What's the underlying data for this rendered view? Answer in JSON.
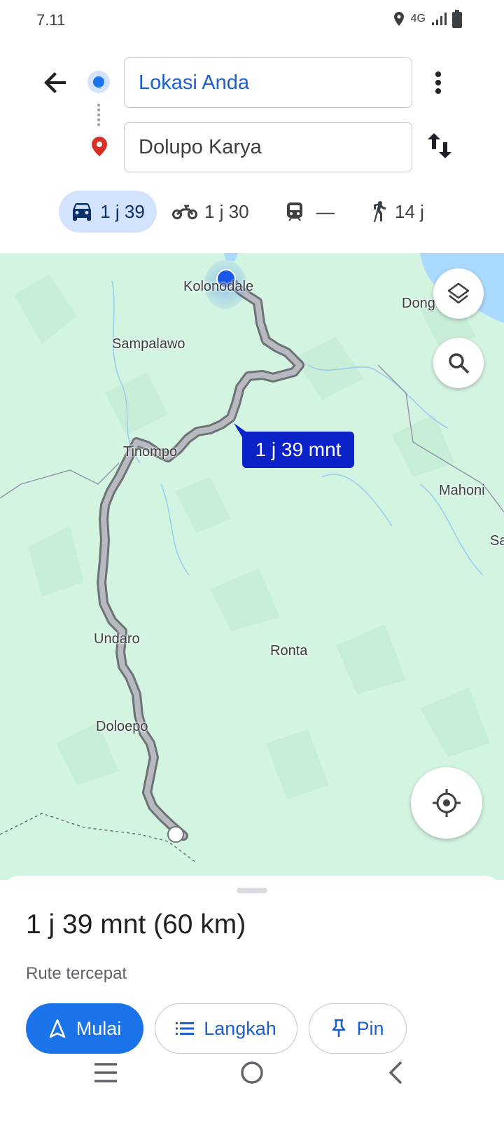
{
  "status_bar": {
    "time": "7.11",
    "network": "4G"
  },
  "route": {
    "origin": "Lokasi Anda",
    "destination": "Dolupo Karya"
  },
  "modes": [
    {
      "name": "car",
      "icon": "car-icon",
      "label": "1 j 39",
      "selected": true
    },
    {
      "name": "motorcycle",
      "icon": "motorcycle-icon",
      "label": "1 j 30"
    },
    {
      "name": "transit",
      "icon": "train-icon",
      "label": "—"
    },
    {
      "name": "walk",
      "icon": "walk-icon",
      "label": "14 j"
    }
  ],
  "map": {
    "places": [
      "Kolonodale",
      "Dong",
      "Sampalawo",
      "Tinompo",
      "Mahoni",
      "Sa",
      "Undaro",
      "Ronta",
      "Doloepo"
    ],
    "eta_bubble": "1 j 39 mnt"
  },
  "sheet": {
    "summary": "1 j 39 mnt (60 km)",
    "subtitle": "Rute tercepat",
    "start_label": "Mulai",
    "steps_label": "Langkah",
    "pin_label": "Pin"
  },
  "colors": {
    "accent": "#1a73e8",
    "map_bg": "#d4f4e2",
    "eta_bubble": "#0b22c8",
    "marker": "#e53935"
  }
}
